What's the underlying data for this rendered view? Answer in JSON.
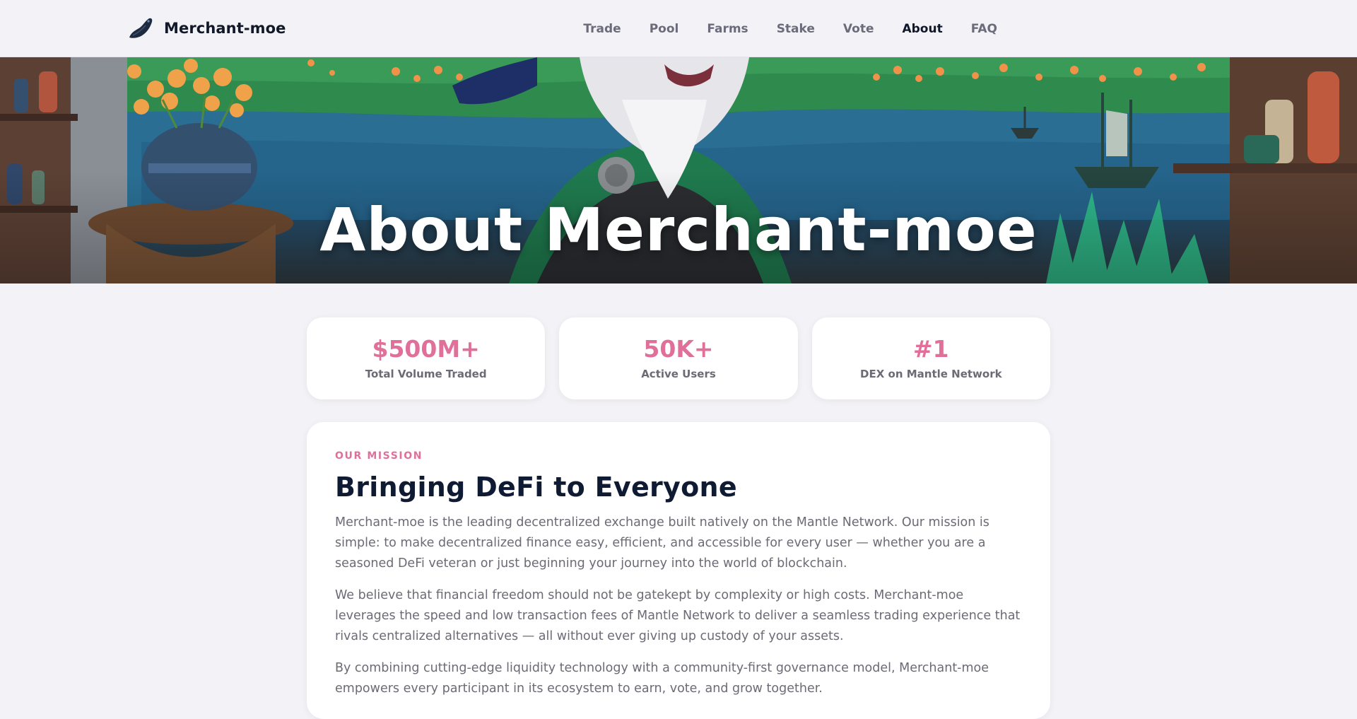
{
  "nav": {
    "brand_name": "Merchant-moe",
    "links": [
      {
        "label": "Trade"
      },
      {
        "label": "Pool"
      },
      {
        "label": "Farms"
      },
      {
        "label": "Stake"
      },
      {
        "label": "Vote"
      },
      {
        "label": "About",
        "active": true
      },
      {
        "label": "FAQ"
      }
    ]
  },
  "hero": {
    "title": "About Merchant-moe"
  },
  "stats": [
    {
      "value": "$500M+",
      "label": "Total Volume Traded"
    },
    {
      "value": "50K+",
      "label": "Active Users"
    },
    {
      "value": "#1",
      "label": "DEX on Mantle Network"
    }
  ],
  "mission": {
    "eyebrow": "OUR MISSION",
    "title": "Bringing DeFi to Everyone",
    "paragraphs": [
      "Merchant-moe is the leading decentralized exchange built natively on the Mantle Network. Our mission is simple: to make decentralized finance easy, efficient, and accessible for every user — whether you are a seasoned DeFi veteran or just beginning your journey into the world of blockchain.",
      "We believe that financial freedom should not be gatekept by complexity or high costs. Merchant-moe leverages the speed and low transaction fees of Mantle Network to deliver a seamless trading experience that rivals centralized alternatives — all without ever giving up custody of your assets.",
      "By combining cutting-edge liquidity technology with a community-first governance model, Merchant-moe empowers every participant in its ecosystem to earn, vote, and grow together."
    ]
  },
  "colors": {
    "accent_pink": "#e0709a",
    "page_bg": "#f3f2f6",
    "heading_dark": "#0f1a33",
    "body_gray": "#6b6b76"
  }
}
